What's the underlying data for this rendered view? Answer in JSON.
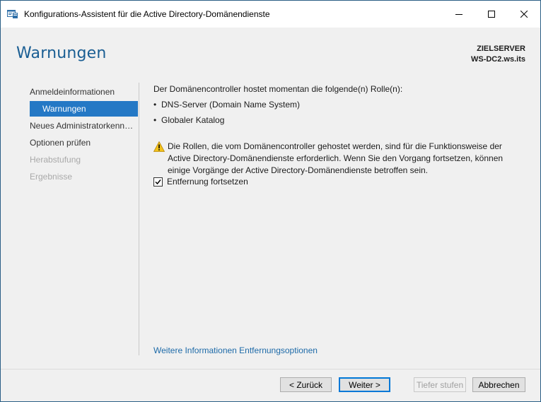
{
  "window": {
    "title": "Konfigurations-Assistent für die Active Directory-Domänendienste",
    "controls": [
      "minimize-icon",
      "maximize-icon",
      "close-icon"
    ]
  },
  "header": {
    "page_title": "Warnungen",
    "target_label": "ZIELSERVER",
    "target_server": "WS-DC2.ws.its"
  },
  "nav": {
    "items": [
      {
        "label": "Anmeldeinformationen",
        "state": "normal"
      },
      {
        "label": "Warnungen",
        "state": "active"
      },
      {
        "label": "Neues Administratorkennwort",
        "state": "normal"
      },
      {
        "label": "Optionen prüfen",
        "state": "normal"
      },
      {
        "label": "Herabstufung",
        "state": "disabled"
      },
      {
        "label": "Ergebnisse",
        "state": "disabled"
      }
    ]
  },
  "content": {
    "intro": "Der Domänencontroller hostet momentan die folgende(n) Rolle(n):",
    "roles": [
      "DNS-Server (Domain Name System)",
      "Globaler Katalog"
    ],
    "warning": "Die Rollen, die vom Domänencontroller gehostet werden, sind für die Funktionsweise der Active Directory-Domänendienste erforderlich. Wenn Sie den Vorgang fortsetzen, können einige Vorgänge der Active Directory-Domänendienste betroffen sein.",
    "checkbox_label": "Entfernung fortsetzen",
    "checkbox_checked": true,
    "more_link": "Weitere Informationen Entfernungsoptionen"
  },
  "footer": {
    "back": "< Zurück",
    "next": "Weiter >",
    "demote_deeper": "Tiefer stufen",
    "cancel": "Abbrechen"
  },
  "colors": {
    "accent": "#2478c5",
    "title": "#1a5e93",
    "link": "#1d6aa8",
    "warning": "#f2c21b"
  }
}
